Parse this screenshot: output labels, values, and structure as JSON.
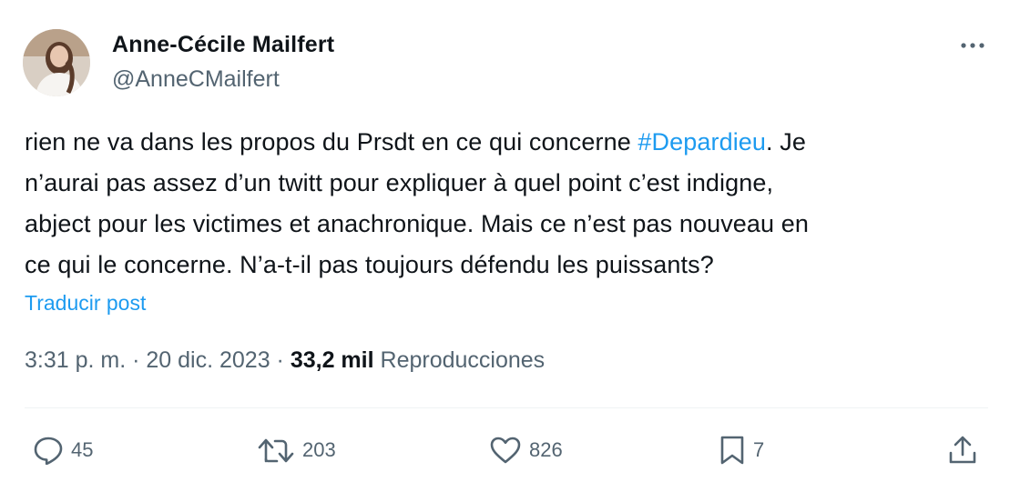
{
  "author": {
    "name": "Anne-Cécile Mailfert",
    "handle": "@AnneCMailfert"
  },
  "tweet": {
    "lines": [
      {
        "before": "rien ne va dans les propos du Prsdt en ce qui concerne ",
        "hashtag": "#Depardieu",
        "after": ". Je"
      },
      {
        "text": "n’aurai pas assez d’un twitt pour expliquer à quel point c’est indigne,"
      },
      {
        "text": "abject pour les victimes et anachronique. Mais ce n’est pas nouveau en"
      },
      {
        "text": "ce qui le concerne. N’a-t-il pas toujours défendu les puissants?"
      }
    ],
    "translate_label": "Traducir post"
  },
  "meta": {
    "time": "3:31 p. m.",
    "separator": " · ",
    "date": "20 dic. 2023",
    "views_count": "33,2 mil",
    "views_label": "Reproducciones"
  },
  "actions": {
    "reply": {
      "icon": "reply-icon",
      "count": "45"
    },
    "repost": {
      "icon": "repost-icon",
      "count": "203"
    },
    "like": {
      "icon": "heart-icon",
      "count": "826"
    },
    "bookmark": {
      "icon": "bookmark-icon",
      "count": "7"
    },
    "share": {
      "icon": "share-icon"
    }
  },
  "colors": {
    "text": "#0f1419",
    "secondary": "#536471",
    "link": "#1d9bf0",
    "divider": "#eff3f4"
  }
}
